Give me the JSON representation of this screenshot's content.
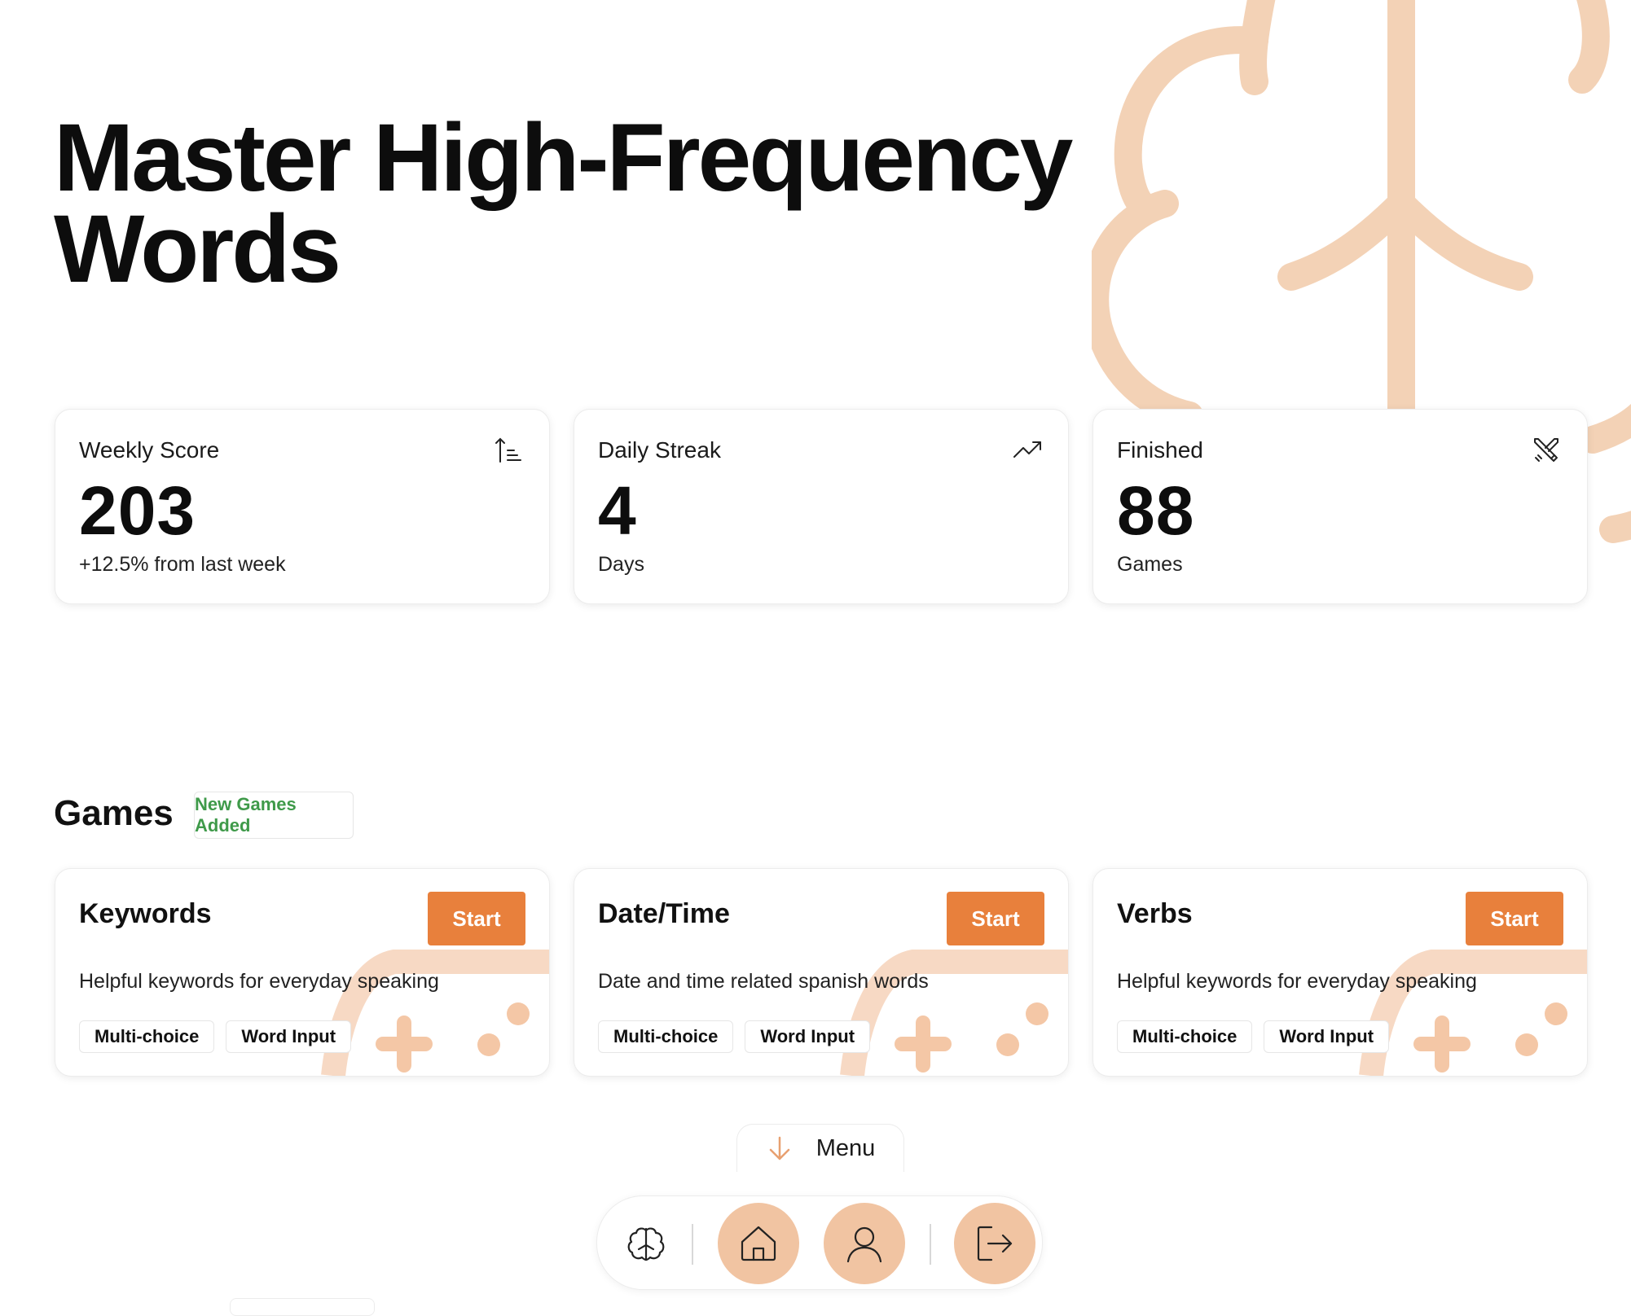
{
  "hero": {
    "title": "Master High-Frequency Words"
  },
  "stats": [
    {
      "label": "Weekly Score",
      "value": "203",
      "sub": "+12.5% from last week",
      "icon": "sort-ascending-icon"
    },
    {
      "label": "Daily Streak",
      "value": "4",
      "sub": "Days",
      "icon": "trending-up-icon"
    },
    {
      "label": "Finished",
      "value": "88",
      "sub": "Games",
      "icon": "crossed-swords-icon"
    }
  ],
  "games_section": {
    "title": "Games",
    "badge": "New Games Added",
    "items": [
      {
        "title": "Keywords",
        "start": "Start",
        "description": "Helpful keywords for everyday speaking",
        "tags": [
          "Multi-choice",
          "Word Input"
        ]
      },
      {
        "title": "Date/Time",
        "start": "Start",
        "description": "Date and time related spanish words",
        "tags": [
          "Multi-choice",
          "Word Input"
        ]
      },
      {
        "title": "Verbs",
        "start": "Start",
        "description": "Helpful keywords for everyday speaking",
        "tags": [
          "Multi-choice",
          "Word Input"
        ]
      }
    ]
  },
  "menu": {
    "label": "Menu",
    "icon": "arrow-down-icon"
  },
  "nav": [
    {
      "icon": "brain-icon",
      "active": false
    },
    {
      "icon": "home-icon",
      "active": true
    },
    {
      "icon": "user-icon",
      "active": true
    },
    {
      "icon": "logout-icon",
      "active": true
    }
  ],
  "colors": {
    "accent": "#e8803c",
    "accent_soft": "#f1c4a2",
    "badge_text": "#3f9a4a",
    "text": "#0d0d0d"
  }
}
